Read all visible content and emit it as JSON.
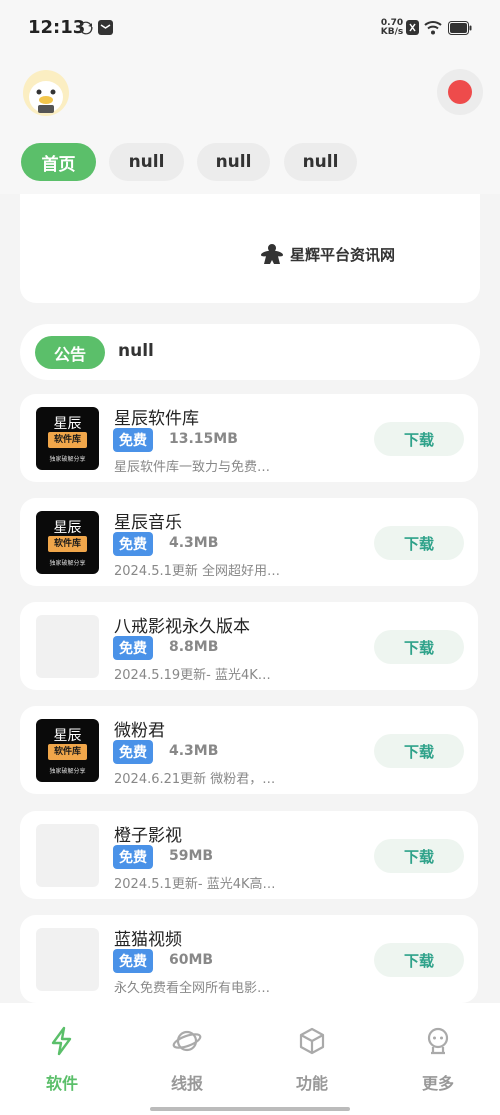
{
  "status_bar": {
    "time": "12:13",
    "net_speed_value": "0.70",
    "net_speed_unit": "KB/s"
  },
  "tabs": [
    "首页",
    "null",
    "null",
    "null"
  ],
  "banner": {
    "brand": "星辉平台资讯网"
  },
  "notice": {
    "label": "公告",
    "text": "null"
  },
  "logo_text": {
    "line1": "星辰",
    "line2": "软件库",
    "line3": "独家破解分享"
  },
  "apps": [
    {
      "name": "星辰软件库",
      "badge": "免费",
      "size": "13.15MB",
      "desc": "星辰软件库一致力与免费…",
      "button": "下载",
      "icon": "logo"
    },
    {
      "name": "星辰音乐",
      "badge": "免费",
      "size": "4.3MB",
      "desc": "2024.5.1更新 全网超好用…",
      "button": "下载",
      "icon": "logo"
    },
    {
      "name": "八戒影视永久版本",
      "badge": "免费",
      "size": "8.8MB",
      "desc": "2024.5.19更新- 蓝光4K…",
      "button": "下载",
      "icon": "placeholder"
    },
    {
      "name": "微粉君",
      "badge": "免费",
      "size": "4.3MB",
      "desc": "2024.6.21更新 微粉君，…",
      "button": "下载",
      "icon": "logo"
    },
    {
      "name": "橙子影视",
      "badge": "免费",
      "size": "59MB",
      "desc": "2024.5.1更新- 蓝光4K高…",
      "button": "下载",
      "icon": "placeholder"
    },
    {
      "name": "蓝猫视频",
      "badge": "免费",
      "size": "60MB",
      "desc": "永久免费看全网所有电影…",
      "button": "下载",
      "icon": "placeholder"
    }
  ],
  "bottom_nav": [
    {
      "label": "软件",
      "icon": "lightning-icon"
    },
    {
      "label": "线报",
      "icon": "planet-icon"
    },
    {
      "label": "功能",
      "icon": "cube-icon"
    },
    {
      "label": "更多",
      "icon": "robot-icon"
    }
  ],
  "colors": {
    "accent_green": "#5bbf6a",
    "badge_blue": "#4a92e8",
    "download_text": "#2fa28a"
  }
}
